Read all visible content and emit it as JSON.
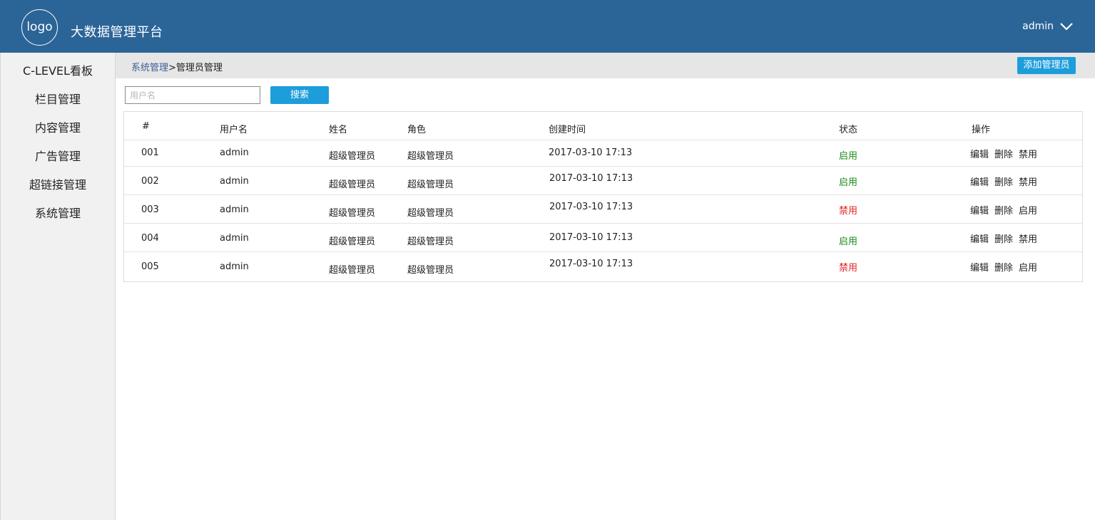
{
  "header": {
    "logo_text": "logo",
    "title": "大数据管理平台",
    "user": "admin"
  },
  "sidebar": {
    "items": [
      {
        "label": "C-LEVEL看板"
      },
      {
        "label": "栏目管理"
      },
      {
        "label": "内容管理"
      },
      {
        "label": "广告管理"
      },
      {
        "label": "超链接管理"
      },
      {
        "label": "系统管理"
      }
    ]
  },
  "breadcrumb": {
    "parent": "系统管理",
    "separator": ">",
    "current": "管理员管理"
  },
  "toolbar": {
    "add_label": "添加管理员",
    "search_placeholder": "用户名",
    "search_value": "",
    "search_label": "搜索"
  },
  "table": {
    "headers": {
      "index": "#",
      "username": "用户名",
      "name": "姓名",
      "role": "角色",
      "created": "创建时间",
      "status": "状态",
      "actions": "操作"
    },
    "rows": [
      {
        "index": "001",
        "username": "admin",
        "name": "超级管理员",
        "role": "超级管理员",
        "created": "2017-03-10 17:13",
        "status": "启用",
        "status_color": "#1a8a1a",
        "edit": "编辑",
        "delete": "删除",
        "toggle": "禁用"
      },
      {
        "index": "002",
        "username": "admin",
        "name": "超级管理员",
        "role": "超级管理员",
        "created": "2017-03-10 17:13",
        "status": "启用",
        "status_color": "#1a8a1a",
        "edit": "编辑",
        "delete": "删除",
        "toggle": "禁用"
      },
      {
        "index": "003",
        "username": "admin",
        "name": "超级管理员",
        "role": "超级管理员",
        "created": "2017-03-10 17:13",
        "status": "禁用",
        "status_color": "#e02020",
        "edit": "编辑",
        "delete": "删除",
        "toggle": "启用"
      },
      {
        "index": "004",
        "username": "admin",
        "name": "超级管理员",
        "role": "超级管理员",
        "created": "2017-03-10 17:13",
        "status": "启用",
        "status_color": "#1a8a1a",
        "edit": "编辑",
        "delete": "删除",
        "toggle": "禁用"
      },
      {
        "index": "005",
        "username": "admin",
        "name": "超级管理员",
        "role": "超级管理员",
        "created": "2017-03-10 17:13",
        "status": "禁用",
        "status_color": "#e02020",
        "edit": "编辑",
        "delete": "删除",
        "toggle": "启用"
      }
    ]
  },
  "colors": {
    "header_bg": "#2b6598",
    "accent_button": "#1e9ddb",
    "status_enabled": "#1a8a1a",
    "status_disabled": "#e02020"
  },
  "icons": {
    "user_menu": "chevron-down-icon"
  }
}
